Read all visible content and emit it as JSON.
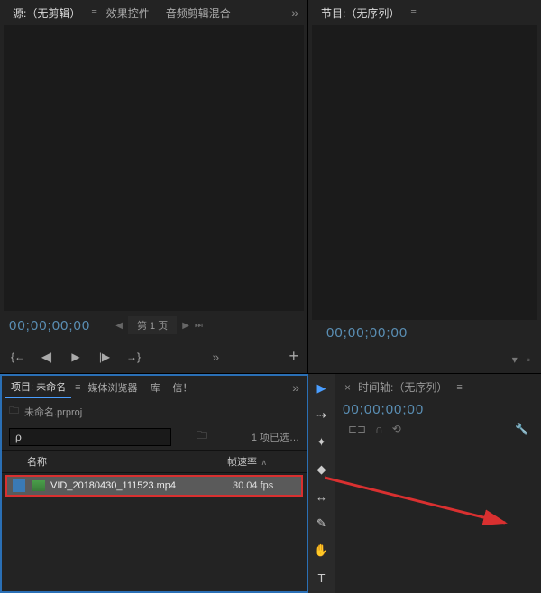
{
  "source": {
    "tabs": [
      {
        "label": "源:（无剪辑）",
        "active": true
      },
      {
        "label": "效果控件",
        "active": false
      },
      {
        "label": "音频剪辑混合",
        "active": false
      }
    ],
    "timecode": "00;00;00;00",
    "page_label": "第 1 页"
  },
  "program": {
    "tab_label": "节目:（无序列）",
    "timecode": "00;00;00;00"
  },
  "project": {
    "tabs": [
      {
        "label": "项目: 未命名",
        "active": true
      },
      {
        "label": "媒体浏览器",
        "active": false
      },
      {
        "label": "库",
        "active": false
      },
      {
        "label": "信！",
        "active": false
      }
    ],
    "file_name": "未命名.prproj",
    "search_placeholder": "",
    "search_value": "ρ",
    "selection_text": "1 项已选…",
    "columns": {
      "name": "名称",
      "fps": "帧速率"
    },
    "items": [
      {
        "name": "VID_20180430_111523.mp4",
        "fps": "30.04 fps"
      }
    ]
  },
  "timeline": {
    "tab_label": "时间轴:（无序列）",
    "timecode": "00;00;00;00"
  },
  "tools": [
    {
      "name": "selection",
      "glyph": "▶",
      "active": true
    },
    {
      "name": "track-select",
      "glyph": "⇢",
      "active": false
    },
    {
      "name": "ripple",
      "glyph": "✦",
      "active": false
    },
    {
      "name": "razor",
      "glyph": "◆",
      "active": false
    },
    {
      "name": "slip",
      "glyph": "↔",
      "active": false
    },
    {
      "name": "pen",
      "glyph": "✎",
      "active": false
    },
    {
      "name": "hand",
      "glyph": "✋",
      "active": false
    },
    {
      "name": "type",
      "glyph": "T",
      "active": false
    }
  ]
}
